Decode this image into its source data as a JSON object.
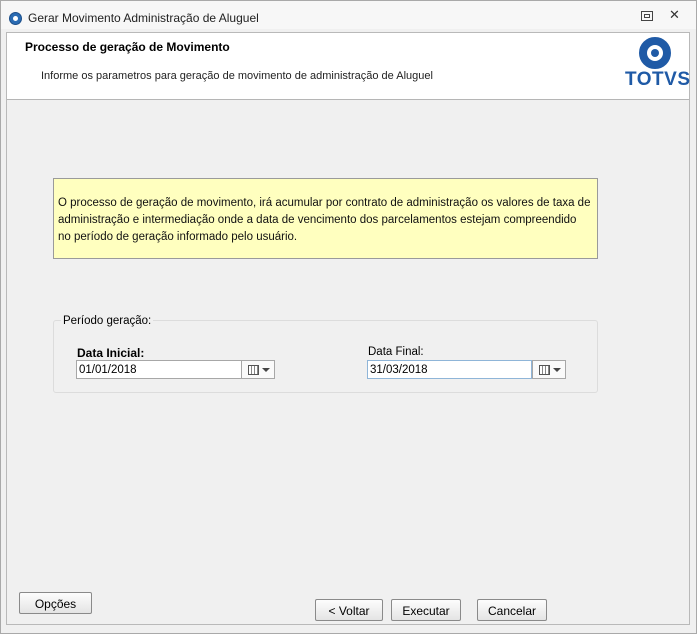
{
  "window": {
    "title": "Gerar Movimento Administração de Aluguel",
    "close_glyph": "✕"
  },
  "header": {
    "title": "Processo de geração de Movimento",
    "subtitle": "Informe os parametros para geração de movimento de administração de Aluguel",
    "logo_text": "TOTVS"
  },
  "info": {
    "text": "O processo de geração de movimento, irá acumular por contrato de administração os valores de taxa de administração e intermediação onde a data de vencimento dos parcelamentos estejam compreendido no período de geração informado pelo usuário."
  },
  "period": {
    "group_label": "Período geração:",
    "start": {
      "label": "Data Inicial:",
      "value": "01/01/2018"
    },
    "end": {
      "label": "Data Final:",
      "value": "31/03/2018"
    }
  },
  "buttons": {
    "options": "Opções",
    "back": "< Voltar",
    "execute": "Executar",
    "cancel": "Cancelar"
  },
  "colors": {
    "info_background": "#ffffbf",
    "brand_blue": "#1f5aa6"
  },
  "icons": [
    "app-icon",
    "restore-icon",
    "close-icon",
    "totvs-logo",
    "calendar-icon",
    "chevron-down-icon"
  ]
}
